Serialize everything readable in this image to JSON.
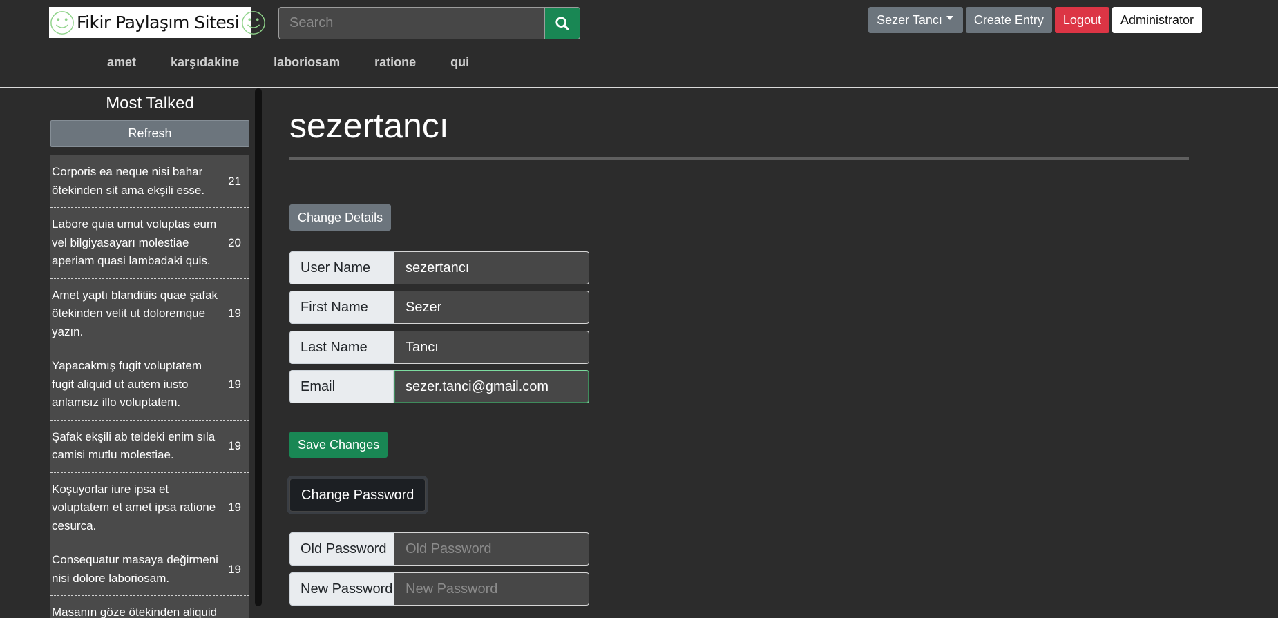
{
  "header": {
    "logo_text": "Fikir Paylaşım Sitesi",
    "search_placeholder": "Search",
    "user_menu_label": "Sezer Tancı",
    "create_entry_label": "Create Entry",
    "logout_label": "Logout",
    "admin_label": "Administrator",
    "nav": [
      "amet",
      "karşıdakine",
      "laboriosam",
      "ratione",
      "qui"
    ]
  },
  "sidebar": {
    "title": "Most Talked",
    "refresh_label": "Refresh",
    "topics": [
      {
        "text": "Corporis ea neque nisi bahar ötekinden sit ama ekşili esse.",
        "count": "21"
      },
      {
        "text": "Labore quia umut voluptas eum vel bilgiyasayarı molestiae aperiam quasi lambadaki quis.",
        "count": "20"
      },
      {
        "text": "Amet yaptı blanditiis quae şafak ötekinden velit ut doloremque yazın.",
        "count": "19"
      },
      {
        "text": "Yapacakmış fugit voluptatem fugit aliquid ut autem iusto anlamsız illo voluptatem.",
        "count": "19"
      },
      {
        "text": "Şafak ekşili ab teldeki enim sıla camisi mutlu molestiae.",
        "count": "19"
      },
      {
        "text": "Koşuyorlar iure ipsa et voluptatem et amet ipsa ratione cesurca.",
        "count": "19"
      },
      {
        "text": "Consequatur masaya değirmeni nisi dolore laboriosam.",
        "count": "19"
      },
      {
        "text": "Masanın göze ötekinden aliquid",
        "count": ""
      }
    ]
  },
  "main": {
    "title": "sezertancı",
    "change_details_label": "Change Details",
    "fields": [
      {
        "label": "User Name",
        "value": "sezertancı"
      },
      {
        "label": "First Name",
        "value": "Sezer"
      },
      {
        "label": "Last Name",
        "value": "Tancı"
      },
      {
        "label": "Email",
        "value": "sezer.tanci@gmail.com"
      }
    ],
    "save_label": "Save Changes",
    "change_password_label": "Change Password",
    "password_fields": [
      {
        "label": "Old Password",
        "placeholder": "Old Password"
      },
      {
        "label": "New Password",
        "placeholder": "New Password"
      }
    ]
  },
  "colors": {
    "background": "#2c2c2c",
    "success": "#198754",
    "danger": "#dc3545",
    "secondary": "#6c757d"
  },
  "icons": [
    "smiley-icon",
    "search-icon",
    "caret-down-icon"
  ]
}
